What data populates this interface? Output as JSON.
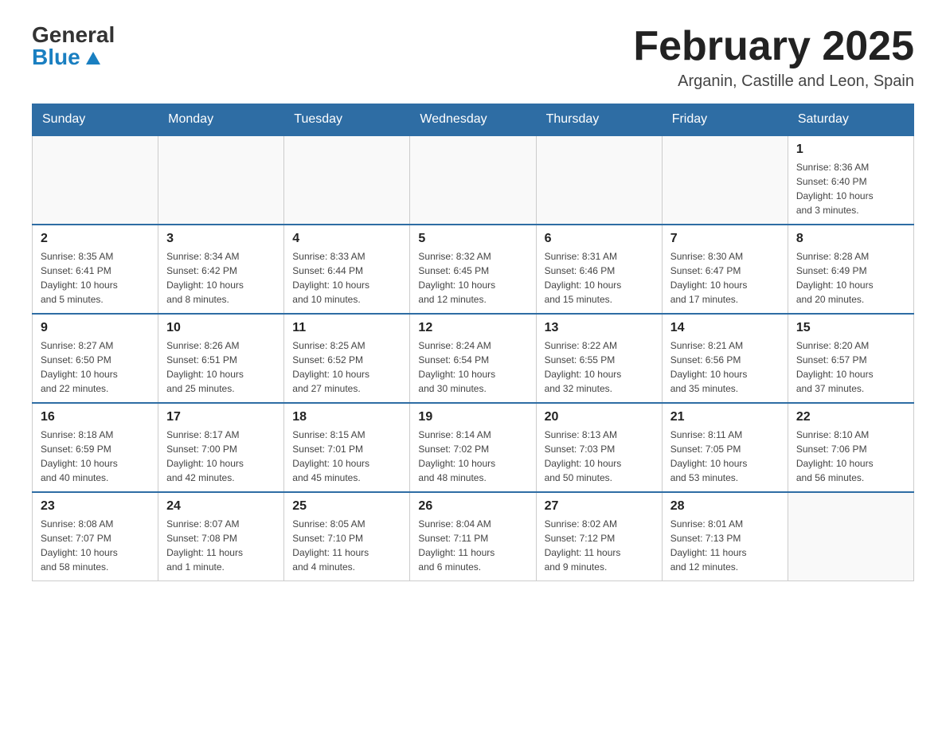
{
  "logo": {
    "line1": "General",
    "line2": "Blue"
  },
  "header": {
    "title": "February 2025",
    "subtitle": "Arganin, Castille and Leon, Spain"
  },
  "weekdays": [
    "Sunday",
    "Monday",
    "Tuesday",
    "Wednesday",
    "Thursday",
    "Friday",
    "Saturday"
  ],
  "weeks": [
    [
      {
        "day": "",
        "info": ""
      },
      {
        "day": "",
        "info": ""
      },
      {
        "day": "",
        "info": ""
      },
      {
        "day": "",
        "info": ""
      },
      {
        "day": "",
        "info": ""
      },
      {
        "day": "",
        "info": ""
      },
      {
        "day": "1",
        "info": "Sunrise: 8:36 AM\nSunset: 6:40 PM\nDaylight: 10 hours\nand 3 minutes."
      }
    ],
    [
      {
        "day": "2",
        "info": "Sunrise: 8:35 AM\nSunset: 6:41 PM\nDaylight: 10 hours\nand 5 minutes."
      },
      {
        "day": "3",
        "info": "Sunrise: 8:34 AM\nSunset: 6:42 PM\nDaylight: 10 hours\nand 8 minutes."
      },
      {
        "day": "4",
        "info": "Sunrise: 8:33 AM\nSunset: 6:44 PM\nDaylight: 10 hours\nand 10 minutes."
      },
      {
        "day": "5",
        "info": "Sunrise: 8:32 AM\nSunset: 6:45 PM\nDaylight: 10 hours\nand 12 minutes."
      },
      {
        "day": "6",
        "info": "Sunrise: 8:31 AM\nSunset: 6:46 PM\nDaylight: 10 hours\nand 15 minutes."
      },
      {
        "day": "7",
        "info": "Sunrise: 8:30 AM\nSunset: 6:47 PM\nDaylight: 10 hours\nand 17 minutes."
      },
      {
        "day": "8",
        "info": "Sunrise: 8:28 AM\nSunset: 6:49 PM\nDaylight: 10 hours\nand 20 minutes."
      }
    ],
    [
      {
        "day": "9",
        "info": "Sunrise: 8:27 AM\nSunset: 6:50 PM\nDaylight: 10 hours\nand 22 minutes."
      },
      {
        "day": "10",
        "info": "Sunrise: 8:26 AM\nSunset: 6:51 PM\nDaylight: 10 hours\nand 25 minutes."
      },
      {
        "day": "11",
        "info": "Sunrise: 8:25 AM\nSunset: 6:52 PM\nDaylight: 10 hours\nand 27 minutes."
      },
      {
        "day": "12",
        "info": "Sunrise: 8:24 AM\nSunset: 6:54 PM\nDaylight: 10 hours\nand 30 minutes."
      },
      {
        "day": "13",
        "info": "Sunrise: 8:22 AM\nSunset: 6:55 PM\nDaylight: 10 hours\nand 32 minutes."
      },
      {
        "day": "14",
        "info": "Sunrise: 8:21 AM\nSunset: 6:56 PM\nDaylight: 10 hours\nand 35 minutes."
      },
      {
        "day": "15",
        "info": "Sunrise: 8:20 AM\nSunset: 6:57 PM\nDaylight: 10 hours\nand 37 minutes."
      }
    ],
    [
      {
        "day": "16",
        "info": "Sunrise: 8:18 AM\nSunset: 6:59 PM\nDaylight: 10 hours\nand 40 minutes."
      },
      {
        "day": "17",
        "info": "Sunrise: 8:17 AM\nSunset: 7:00 PM\nDaylight: 10 hours\nand 42 minutes."
      },
      {
        "day": "18",
        "info": "Sunrise: 8:15 AM\nSunset: 7:01 PM\nDaylight: 10 hours\nand 45 minutes."
      },
      {
        "day": "19",
        "info": "Sunrise: 8:14 AM\nSunset: 7:02 PM\nDaylight: 10 hours\nand 48 minutes."
      },
      {
        "day": "20",
        "info": "Sunrise: 8:13 AM\nSunset: 7:03 PM\nDaylight: 10 hours\nand 50 minutes."
      },
      {
        "day": "21",
        "info": "Sunrise: 8:11 AM\nSunset: 7:05 PM\nDaylight: 10 hours\nand 53 minutes."
      },
      {
        "day": "22",
        "info": "Sunrise: 8:10 AM\nSunset: 7:06 PM\nDaylight: 10 hours\nand 56 minutes."
      }
    ],
    [
      {
        "day": "23",
        "info": "Sunrise: 8:08 AM\nSunset: 7:07 PM\nDaylight: 10 hours\nand 58 minutes."
      },
      {
        "day": "24",
        "info": "Sunrise: 8:07 AM\nSunset: 7:08 PM\nDaylight: 11 hours\nand 1 minute."
      },
      {
        "day": "25",
        "info": "Sunrise: 8:05 AM\nSunset: 7:10 PM\nDaylight: 11 hours\nand 4 minutes."
      },
      {
        "day": "26",
        "info": "Sunrise: 8:04 AM\nSunset: 7:11 PM\nDaylight: 11 hours\nand 6 minutes."
      },
      {
        "day": "27",
        "info": "Sunrise: 8:02 AM\nSunset: 7:12 PM\nDaylight: 11 hours\nand 9 minutes."
      },
      {
        "day": "28",
        "info": "Sunrise: 8:01 AM\nSunset: 7:13 PM\nDaylight: 11 hours\nand 12 minutes."
      },
      {
        "day": "",
        "info": ""
      }
    ]
  ]
}
